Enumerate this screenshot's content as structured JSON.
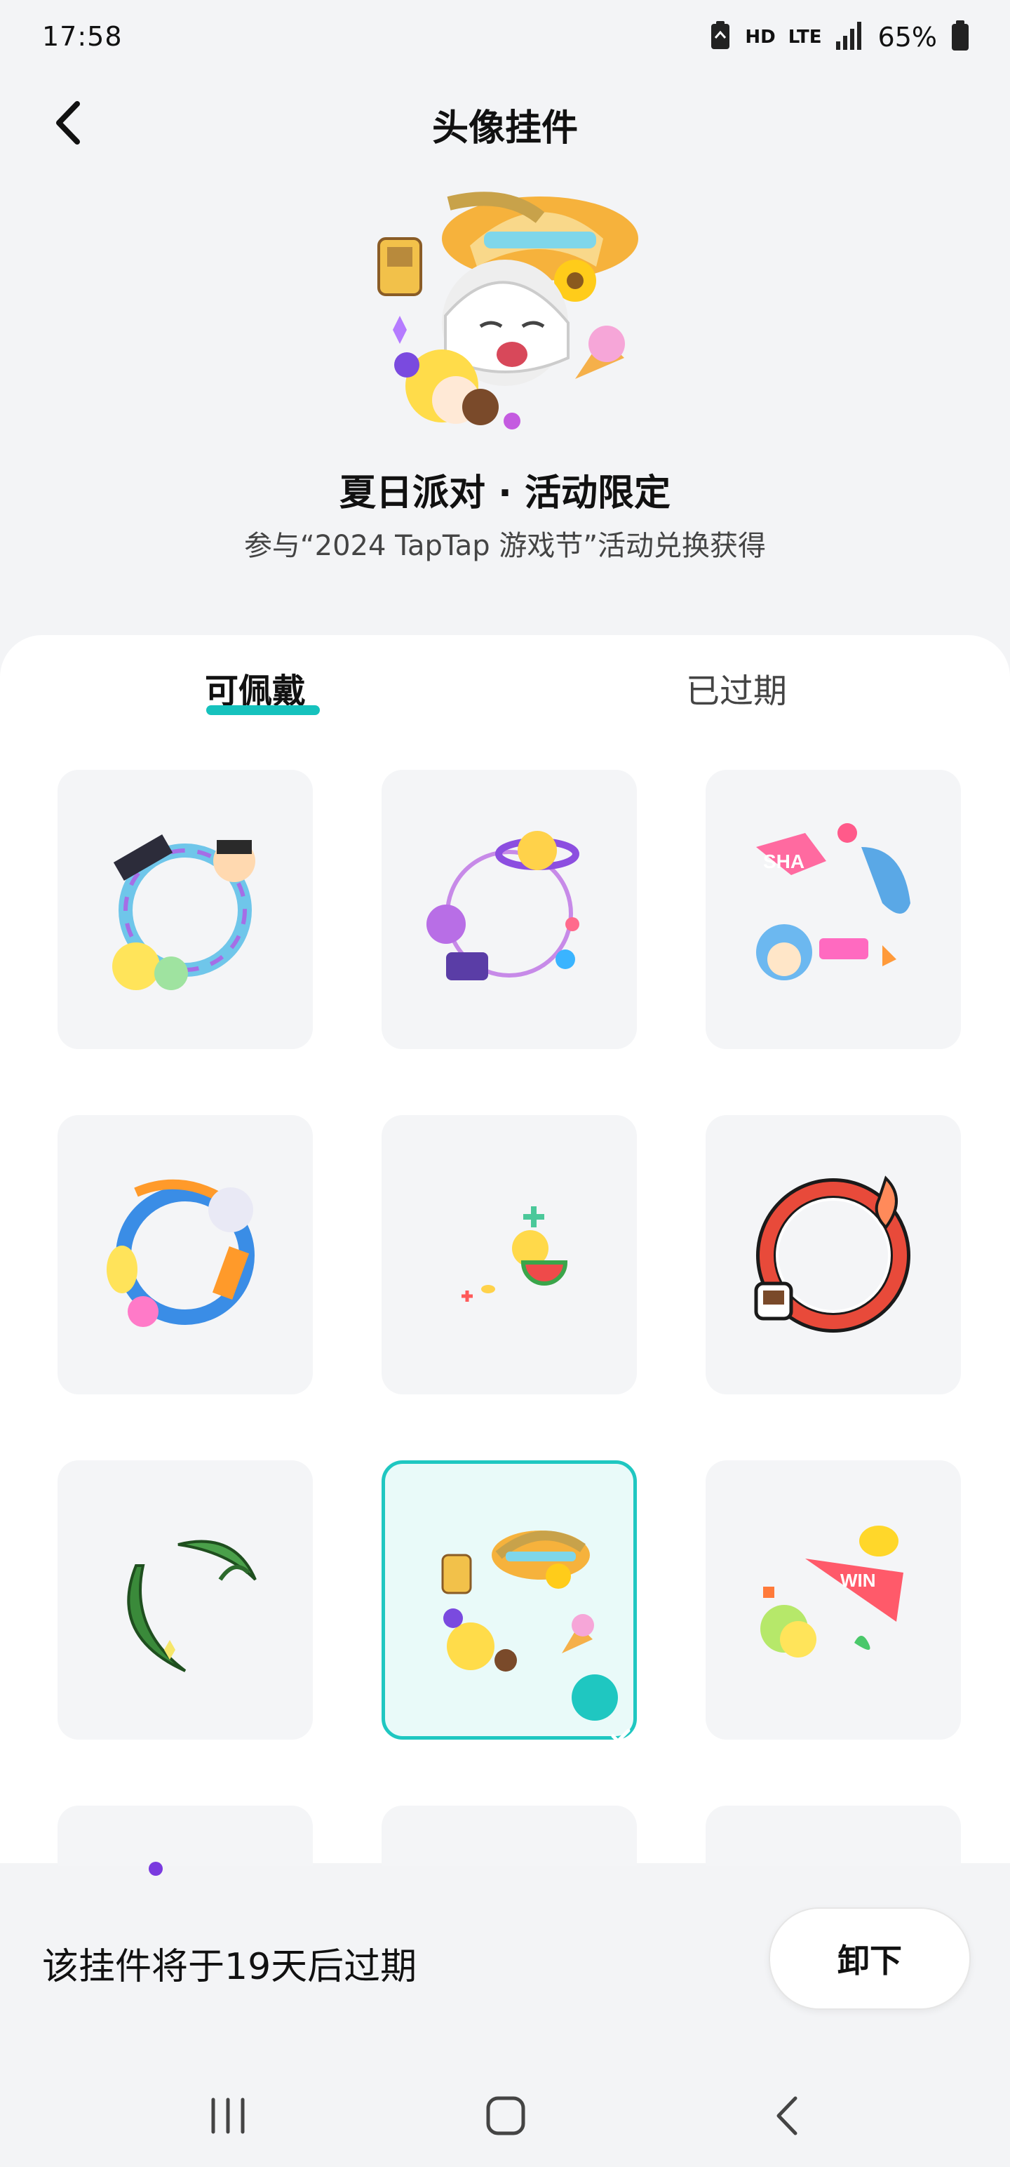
{
  "status": {
    "time": "17:58",
    "hd": "HD",
    "lte": "LTE",
    "battery": "65%"
  },
  "header": {
    "title": "头像挂件"
  },
  "preview": {
    "title": "夏日派对 · 活动限定",
    "subtitle": "参与“2024 TapTap 游戏节”活动兑换获得"
  },
  "tabs": [
    {
      "label": "可佩戴",
      "active": true
    },
    {
      "label": "已过期",
      "active": false
    }
  ],
  "frames": [
    {
      "name": "pixel-frame",
      "selected": false
    },
    {
      "name": "galaxy-frame",
      "selected": false
    },
    {
      "name": "shark-frame",
      "selected": false
    },
    {
      "name": "ribbon-frame",
      "selected": false
    },
    {
      "name": "watermelon-frame",
      "selected": false
    },
    {
      "name": "red-ring-frame",
      "selected": false
    },
    {
      "name": "leaf-frame",
      "selected": false
    },
    {
      "name": "summer-hat-frame",
      "selected": true
    },
    {
      "name": "win-duck-frame",
      "selected": false
    },
    {
      "name": "partial-frame-1",
      "selected": false
    },
    {
      "name": "partial-frame-2",
      "selected": false
    },
    {
      "name": "partial-frame-3",
      "selected": false
    }
  ],
  "footer": {
    "expire_text": "该挂件将于19天后过期",
    "unload_label": "卸下"
  },
  "colors": {
    "accent": "#1fc7c1",
    "tile_bg": "#f4f5f7",
    "page_bg": "#f3f4f6"
  }
}
